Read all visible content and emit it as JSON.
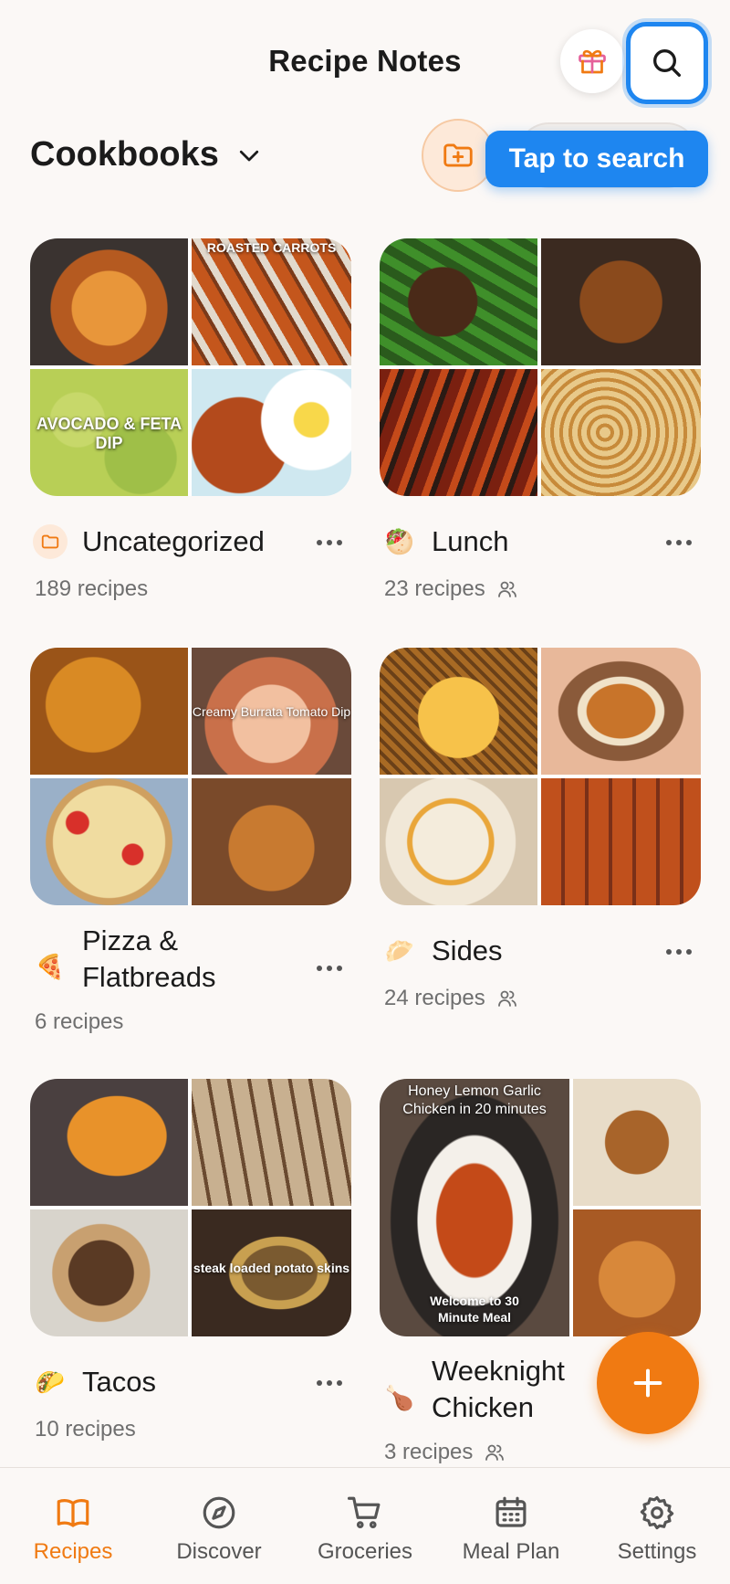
{
  "header": {
    "title": "Recipe Notes",
    "gift_icon": "gift-icon",
    "search_icon": "search-icon"
  },
  "cookbooks": {
    "title": "Cookbooks",
    "new_folder_icon": "folder-plus-icon",
    "tooltip": "Tap to search"
  },
  "cards": [
    {
      "name": "Uncategorized",
      "count": "189 recipes",
      "icon": "folder-icon",
      "emoji": "",
      "shared": false,
      "captions": [
        "",
        "ROASTED CARROTS",
        "AVOCADO & FETA DIP",
        ""
      ]
    },
    {
      "name": "Lunch",
      "count": "23 recipes",
      "icon": "sandwich-icon",
      "emoji": "🥙",
      "shared": true,
      "captions": [
        "",
        "",
        "",
        ""
      ]
    },
    {
      "name": "Pizza & Flatbreads",
      "count": "6 recipes",
      "icon": "pizza-icon",
      "emoji": "🍕",
      "shared": false,
      "captions": [
        "",
        "Creamy Burrata Tomato Dip",
        "",
        ""
      ]
    },
    {
      "name": "Sides",
      "count": "24 recipes",
      "icon": "sides-icon",
      "emoji": "🥟",
      "shared": true,
      "captions": [
        "",
        "",
        "",
        ""
      ]
    },
    {
      "name": "Tacos",
      "count": "10 recipes",
      "icon": "taco-icon",
      "emoji": "🌮",
      "shared": false,
      "captions": [
        "",
        "",
        "",
        "steak loaded potato skins"
      ]
    },
    {
      "name": "Weeknight Chicken",
      "count": "3 recipes",
      "icon": "chicken-icon",
      "emoji": "🍗",
      "shared": true,
      "captions": [
        "Honey Lemon Garlic Chicken in 20 minutes",
        "",
        "",
        "Welcome to 30 Minute Meal"
      ]
    }
  ],
  "fab": {
    "icon": "plus-icon"
  },
  "tabs": [
    {
      "label": "Recipes",
      "icon": "book-icon",
      "active": true
    },
    {
      "label": "Discover",
      "icon": "compass-icon",
      "active": false
    },
    {
      "label": "Groceries",
      "icon": "cart-icon",
      "active": false
    },
    {
      "label": "Meal Plan",
      "icon": "calendar-icon",
      "active": false
    },
    {
      "label": "Settings",
      "icon": "gear-icon",
      "active": false
    }
  ],
  "colors": {
    "accent": "#f07a12",
    "highlight": "#1e86f0",
    "background": "#fbf8f6"
  }
}
